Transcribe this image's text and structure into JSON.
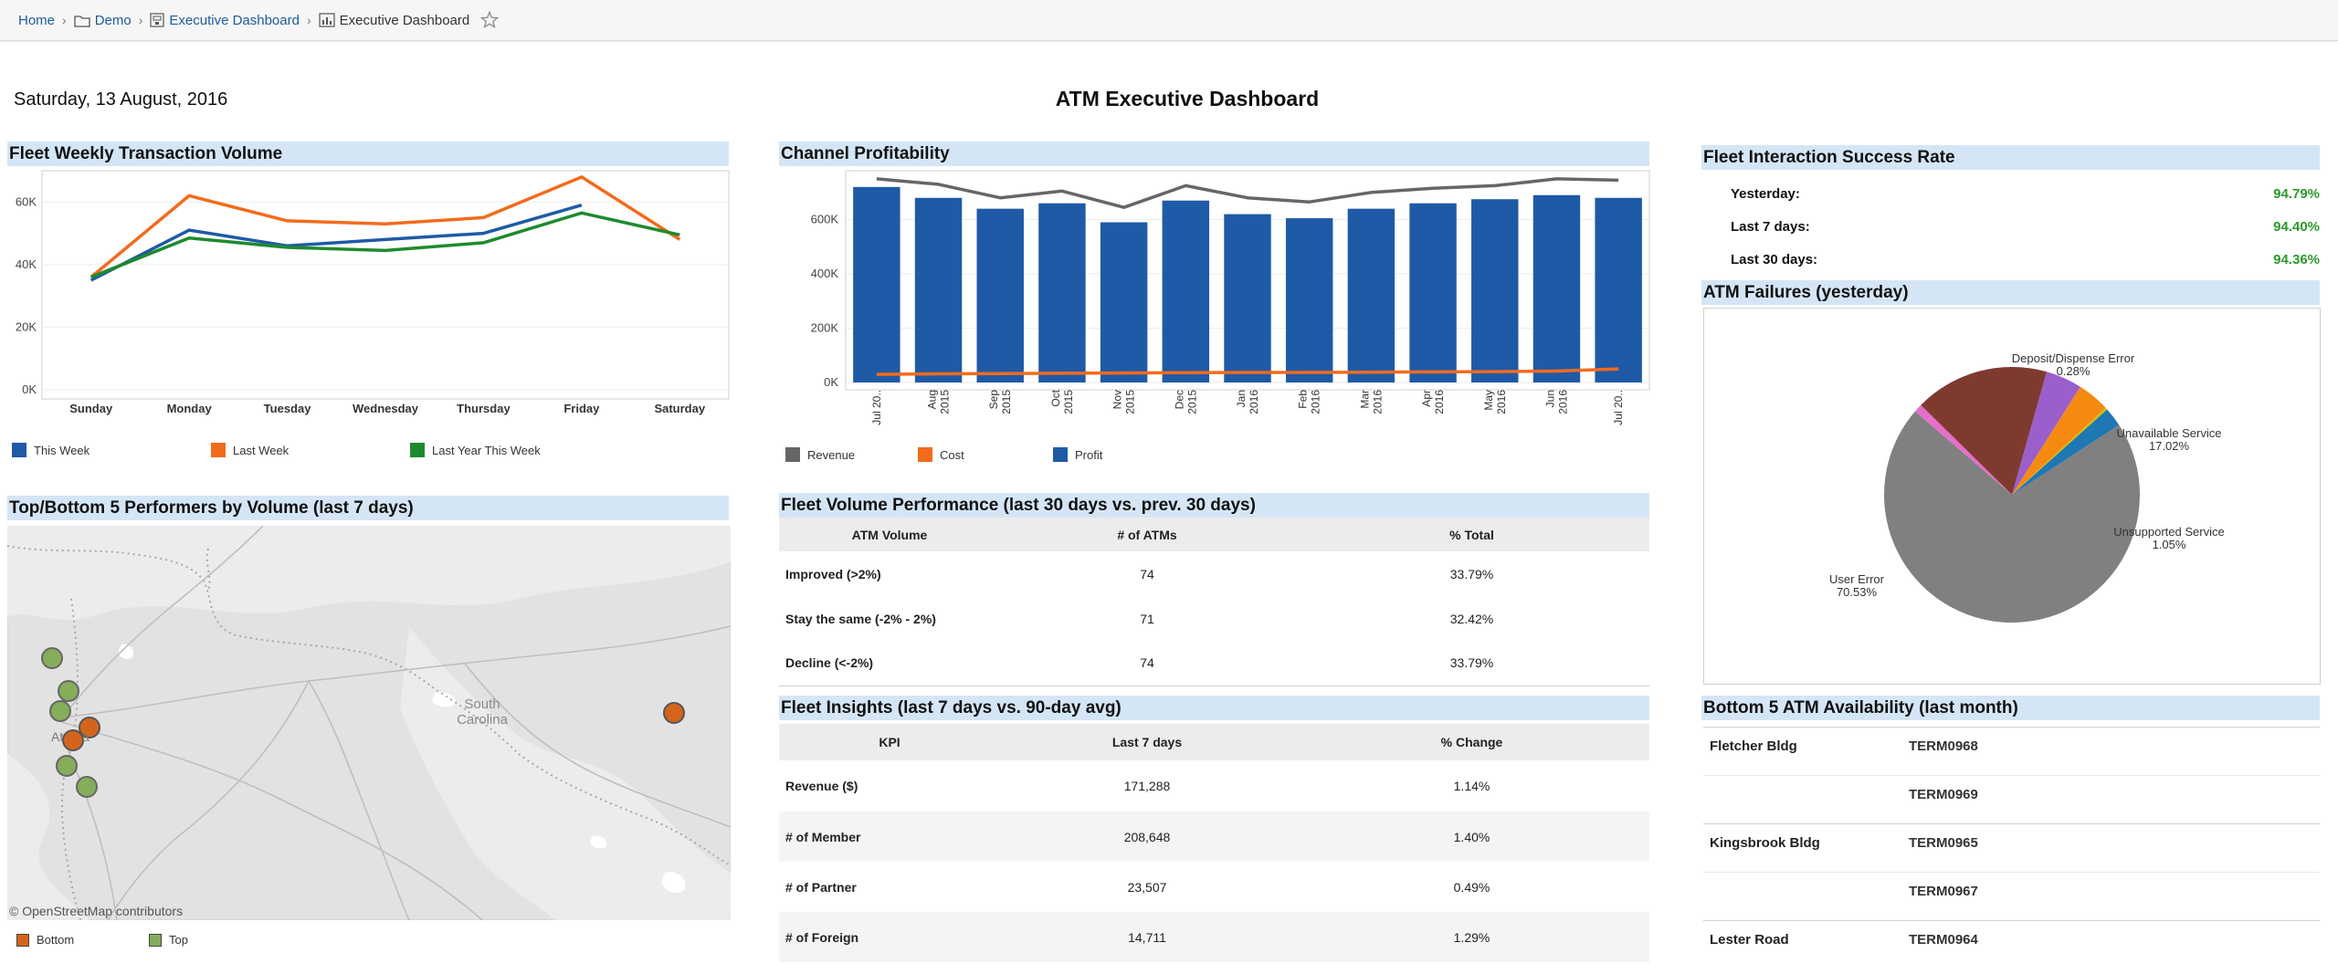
{
  "breadcrumb": {
    "items": [
      "Home",
      "Demo",
      "Executive Dashboard",
      "Executive Dashboard"
    ],
    "favorite_icon": "star-outline-icon"
  },
  "header": {
    "date": "Saturday, 13 August, 2016",
    "title": "ATM Executive Dashboard"
  },
  "panels": {
    "weekly": "Fleet Weekly Transaction Volume",
    "channel": "Channel Profitability",
    "success": "Fleet Interaction Success Rate",
    "failures": "ATM Failures (yesterday)",
    "performers": "Top/Bottom 5 Performers by Volume (last 7 days)",
    "volume_perf": "Fleet Volume Performance (last 30 days vs. prev. 30 days)",
    "insights": "Fleet Insights (last 7 days vs. 90-day avg)",
    "availability": "Bottom 5 ATM Availability (last month)"
  },
  "success_rate": [
    {
      "label": "Yesterday:",
      "value": "94.79%"
    },
    {
      "label": "Last 7 days:",
      "value": "94.40%"
    },
    {
      "label": "Last 30 days:",
      "value": "94.36%"
    }
  ],
  "volume_table": {
    "headers": [
      "ATM Volume",
      "# of ATMs",
      "% Total"
    ],
    "rows": [
      [
        "Improved (>2%)",
        "74",
        "33.79%"
      ],
      [
        "Stay the same (-2% - 2%)",
        "71",
        "32.42%"
      ],
      [
        "Decline (<-2%)",
        "74",
        "33.79%"
      ]
    ]
  },
  "insights_table": {
    "headers": [
      "KPI",
      "Last 7 days",
      "% Change"
    ],
    "rows": [
      [
        "Revenue ($)",
        "171,288",
        "1.14%"
      ],
      [
        "# of Member",
        "208,648",
        "1.40%"
      ],
      [
        "# of Partner",
        "23,507",
        "0.49%"
      ],
      [
        "# of Foreign",
        "14,711",
        "1.29%"
      ]
    ]
  },
  "availability": [
    {
      "location": "Fletcher Bldg",
      "terminal": "TERM0968"
    },
    {
      "location": "",
      "terminal": "TERM0969"
    },
    {
      "location": "Kingsbrook Bldg",
      "terminal": "TERM0965"
    },
    {
      "location": "",
      "terminal": "TERM0967"
    },
    {
      "location": "Lester Road",
      "terminal": "TERM0964"
    }
  ],
  "map": {
    "label_state": "South",
    "label_state2": "Carolina",
    "label_city": "At",
    "label_city2": "a",
    "attribution": "© OpenStreetMap contributors",
    "legend": [
      {
        "name": "Bottom",
        "color": "#d4641c"
      },
      {
        "name": "Top",
        "color": "#86ad5a"
      }
    ]
  },
  "chart_data": [
    {
      "type": "line",
      "categories": [
        "Sunday",
        "Monday",
        "Tuesday",
        "Wednesday",
        "Thursday",
        "Friday",
        "Saturday"
      ],
      "series": [
        {
          "name": "This Week",
          "color": "#1f5aa6",
          "values": [
            35000,
            51000,
            46000,
            48000,
            50000,
            59000,
            null
          ]
        },
        {
          "name": "Last Week",
          "color": "#f26b1d",
          "values": [
            36000,
            62000,
            54000,
            53000,
            55000,
            68000,
            48000
          ]
        },
        {
          "name": "Last Year This Week",
          "color": "#1e8a2e",
          "values": [
            36000,
            48500,
            45500,
            44500,
            47000,
            56500,
            49500
          ]
        }
      ],
      "y_ticks": [
        "0K",
        "20K",
        "40K",
        "60K"
      ],
      "ylim": [
        0,
        70000
      ]
    },
    {
      "type": "bar",
      "categories": [
        [
          "Jul 20.."
        ],
        [
          "Aug",
          "2015"
        ],
        [
          "Sep",
          "2015"
        ],
        [
          "Oct",
          "2015"
        ],
        [
          "Nov",
          "2015"
        ],
        [
          "Dec",
          "2015"
        ],
        [
          "Jan",
          "2016"
        ],
        [
          "Feb",
          "2016"
        ],
        [
          "Mar",
          "2016"
        ],
        [
          "Apr",
          "2016"
        ],
        [
          "May",
          "2016"
        ],
        [
          "Jun",
          "2016"
        ],
        [
          "Jul 20.."
        ]
      ],
      "series": [
        {
          "name": "Profit",
          "kind": "bar",
          "color": "#1f5aa6",
          "values": [
            720000,
            680000,
            640000,
            660000,
            590000,
            670000,
            620000,
            605000,
            640000,
            660000,
            675000,
            690000,
            680000
          ]
        },
        {
          "name": "Revenue",
          "kind": "line",
          "color": "#666666",
          "values": [
            750000,
            730000,
            680000,
            705000,
            645000,
            725000,
            680000,
            665000,
            700000,
            715000,
            725000,
            750000,
            745000
          ]
        },
        {
          "name": "Cost",
          "kind": "line",
          "color": "#f26b1d",
          "values": [
            30000,
            32000,
            33000,
            34000,
            35000,
            36000,
            37000,
            37000,
            38000,
            39000,
            40000,
            42000,
            50000
          ]
        }
      ],
      "y_ticks": [
        "0K",
        "200K",
        "400K",
        "600K"
      ],
      "ylim": [
        0,
        780000
      ]
    },
    {
      "type": "pie",
      "slices": [
        {
          "label": "User Error",
          "value": 70.53,
          "color": "#808080"
        },
        {
          "label": "Unsupported Service",
          "value": 1.05,
          "color": "#e56fcb"
        },
        {
          "label": "Unavailable Service",
          "value": 17.02,
          "color": "#7f3a30"
        },
        {
          "label": "Purple",
          "value": 4.6,
          "color": "#9b5fcb"
        },
        {
          "label": "Orange",
          "value": 4.1,
          "color": "#f58a11"
        },
        {
          "label": "Deposit/Dispense Error",
          "value": 0.28,
          "color": "#d8c000"
        },
        {
          "label": "Blue",
          "value": 2.42,
          "color": "#1f77b4"
        }
      ],
      "labels": [
        {
          "name": "Deposit/Dispense Error",
          "pct": "0.28%"
        },
        {
          "name": "Unavailable Service",
          "pct": "17.02%"
        },
        {
          "name": "Unsupported Service",
          "pct": "1.05%"
        },
        {
          "name": "User Error",
          "pct": "70.53%"
        }
      ]
    }
  ]
}
